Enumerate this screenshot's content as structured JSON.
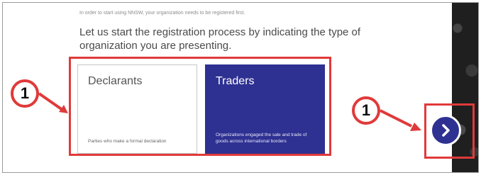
{
  "intro_text": "In order to start using NNSW, your organization needs to be registered first.",
  "heading": "Let us start the registration process by indicating the type of organization you are presenting.",
  "cards": [
    {
      "title": "Declarants",
      "description": "Parties who make a formal declaration"
    },
    {
      "title": "Traders",
      "description": "Organizations engaged the sale and trade of goods across international borders"
    }
  ],
  "callouts": {
    "left": "1",
    "right": "1"
  },
  "next_button": {
    "icon": "chevron-right-icon",
    "color": "#2e3192"
  },
  "colors": {
    "highlight": "#e03a3a",
    "brand": "#2e3192"
  }
}
